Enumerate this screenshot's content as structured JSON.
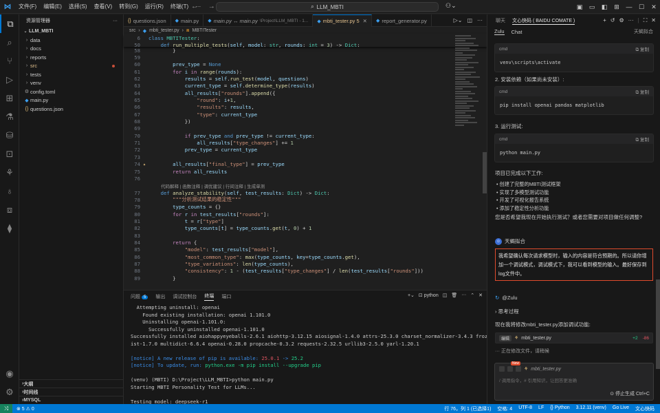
{
  "titlebar": {
    "menu": [
      "文件(F)",
      "编辑(E)",
      "选择(S)",
      "查看(V)",
      "转到(G)",
      "运行(R)",
      "终端(T)",
      "···"
    ],
    "search": "LLM_MBTI",
    "nav": "← →"
  },
  "sidebar": {
    "title": "资源管理器",
    "project": "LLM_MBTI",
    "items": [
      {
        "label": "data",
        "type": "folder"
      },
      {
        "label": "docs",
        "type": "folder"
      },
      {
        "label": "reports",
        "type": "folder"
      },
      {
        "label": "src",
        "type": "folder",
        "modified": true
      },
      {
        "label": "tests",
        "type": "folder"
      },
      {
        "label": "venv",
        "type": "folder"
      },
      {
        "label": "config.toml",
        "type": "file",
        "icon": "gear-icon"
      },
      {
        "label": "main.py",
        "type": "file",
        "icon": "python-icon"
      },
      {
        "label": "questions.json",
        "type": "file",
        "icon": "json-icon"
      }
    ],
    "sections": [
      "大纲",
      "时间线",
      "MYSQL"
    ]
  },
  "tabs": [
    {
      "label": "questions.json",
      "icon": "{}",
      "active": false
    },
    {
      "label": "main.py",
      "icon": "◆",
      "active": false
    },
    {
      "label": "main.py ↔ main.py",
      "sub": "\\Project\\LLM_MBTI - 1...",
      "icon": "◆",
      "active": false,
      "italic": true
    },
    {
      "label": "mbti_tester.py 5",
      "icon": "◆",
      "active": true,
      "modified": true
    },
    {
      "label": "report_generator.py",
      "icon": "◆",
      "active": false
    }
  ],
  "breadcrumb": [
    "src",
    "mbti_tester.py",
    "MBTITester"
  ],
  "sticky": [
    {
      "ln": "6",
      "html": "<span class='k'>class</span> <span class='c'>MBTITester</span>:"
    },
    {
      "ln": "50",
      "html": "    <span class='k'>def</span> <span class='f'>run_multiple_tests</span>(<span class='v'>self</span>, <span class='v'>model</span>: <span class='c'>str</span>, <span class='v'>rounds</span>: <span class='c'>int</span> = <span class='n'>3</span>) -> <span class='c'>Dict</span>:"
    }
  ],
  "code": [
    {
      "ln": "58",
      "html": "        <span class='p'>}</span>"
    },
    {
      "ln": "59",
      "html": ""
    },
    {
      "ln": "60",
      "html": "        <span class='v'>prev_type</span> = <span class='k'>None</span>"
    },
    {
      "ln": "61",
      "html": "        <span class='kc'>for</span> <span class='v'>i</span> <span class='kc'>in</span> <span class='f'>range</span>(<span class='v'>rounds</span>):"
    },
    {
      "ln": "62",
      "html": "            <span class='v'>results</span> = <span class='v'>self</span>.<span class='f'>run_test</span>(<span class='v'>model</span>, <span class='v'>questions</span>)"
    },
    {
      "ln": "63",
      "html": "            <span class='v'>current_type</span> = <span class='v'>self</span>.<span class='f'>determine_type</span>(<span class='v'>results</span>)"
    },
    {
      "ln": "64",
      "html": "            <span class='v'>all_results</span>[<span class='s'>\"rounds\"</span>].<span class='f'>append</span>({"
    },
    {
      "ln": "65",
      "html": "                <span class='s'>\"round\"</span>: <span class='v'>i</span>+<span class='n'>1</span>,"
    },
    {
      "ln": "66",
      "html": "                <span class='s'>\"results\"</span>: <span class='v'>results</span>,"
    },
    {
      "ln": "67",
      "html": "                <span class='s'>\"type\"</span>: <span class='v'>current_type</span>"
    },
    {
      "ln": "68",
      "html": "            })"
    },
    {
      "ln": "69",
      "html": ""
    },
    {
      "ln": "70",
      "html": "            <span class='kc'>if</span> <span class='v'>prev_type</span> <span class='k'>and</span> <span class='v'>prev_type</span> != <span class='v'>current_type</span>:"
    },
    {
      "ln": "71",
      "html": "                <span class='v'>all_results</span>[<span class='s'>\"type_changes\"</span>] += <span class='n'>1</span>"
    },
    {
      "ln": "72",
      "html": "            <span class='v'>prev_type</span> = <span class='v'>current_type</span>"
    },
    {
      "ln": "73",
      "html": ""
    },
    {
      "ln": "74",
      "html": "        <span class='v'>all_results</span>[<span class='s'>\"final_type\"</span>] = <span class='v'>prev_type</span>",
      "gutter": "✦"
    },
    {
      "ln": "75",
      "html": "        <span class='kc'>return</span> <span class='v'>all_results</span>"
    },
    {
      "ln": "76",
      "html": ""
    },
    {
      "lens": "代码解释 | 函数注释 | 调优建议 | 行间注释 | 生成单测"
    },
    {
      "ln": "77",
      "html": "    <span class='k'>def</span> <span class='f'>analyze_stability</span>(<span class='v'>self</span>, <span class='v'>test_results</span>: <span class='c'>Dict</span>) -> <span class='c'>Dict</span>:"
    },
    {
      "ln": "78",
      "html": "        <span class='s'>\"\"\"分析测试结果的稳定性\"\"\"</span>"
    },
    {
      "ln": "79",
      "html": "        <span class='v'>type_counts</span> = {}"
    },
    {
      "ln": "80",
      "html": "        <span class='kc'>for</span> <span class='v'>r</span> <span class='kc'>in</span> <span class='v'>test_results</span>[<span class='s'>\"rounds\"</span>]:"
    },
    {
      "ln": "81",
      "html": "            <span class='v'>t</span> = <span class='v'>r</span>[<span class='s'>\"type\"</span>]"
    },
    {
      "ln": "82",
      "html": "            <span class='v'>type_counts</span>[<span class='v'>t</span>] = <span class='v'>type_counts</span>.<span class='f'>get</span>(<span class='v'>t</span>, <span class='n'>0</span>) + <span class='n'>1</span>"
    },
    {
      "ln": "83",
      "html": ""
    },
    {
      "ln": "84",
      "html": "        <span class='kc'>return</span> {"
    },
    {
      "ln": "85",
      "html": "            <span class='s'>\"model\"</span>: <span class='v'>test_results</span>[<span class='s'>\"model\"</span>],"
    },
    {
      "ln": "86",
      "html": "            <span class='s'>\"most_common_type\"</span>: <span class='f'>max</span>(<span class='v'>type_counts</span>, <span class='v'>key</span>=<span class='v'>type_counts</span>.<span class='f'>get</span>),"
    },
    {
      "ln": "87",
      "html": "            <span class='s'>\"type_variations\"</span>: <span class='f'>len</span>(<span class='v'>type_counts</span>),"
    },
    {
      "ln": "88",
      "html": "            <span class='s'>\"consistency\"</span>: <span class='n'>1</span> - (<span class='v'>test_results</span>[<span class='s'>\"type_changes\"</span>] / <span class='f'>len</span>(<span class='v'>test_results</span>[<span class='s'>\"rounds\"</span>]))"
    },
    {
      "ln": "89",
      "html": "        }"
    }
  ],
  "panel": {
    "tabs": [
      "问题",
      "输出",
      "调试控制台",
      "终端",
      "端口"
    ],
    "problems_count": "5",
    "active_tab": "终端",
    "terminal_label": "python",
    "lines": [
      {
        "t": "  Attempting uninstall: openai"
      },
      {
        "t": "    Found existing installation: openai 1.101.0"
      },
      {
        "t": "    Uninstalling openai-1.101.0:"
      },
      {
        "t": "      Successfully uninstalled openai-1.101.0"
      },
      {
        "t": "Successfully installed aiohappyeyeballs-2.6.1 aiohttp-3.12.15 aiosignal-1.4.0 attrs-25.3.0 charset_normalizer-3.4.3 frozenl"
      },
      {
        "t": "ist-1.7.0 multidict-6.6.4 openai-0.28.0 propcache-0.3.2 requests-2.32.5 urllib3-2.5.0 yarl-1.20.1"
      },
      {
        "t": ""
      },
      {
        "t": "[notice] A new release of pip is available: ",
        "red": "25.0.1",
        "mid": " -> ",
        "green": "25.2",
        "notice": true
      },
      {
        "t": "[notice] To update, run: ",
        "green2": "python.exe -m pip install --upgrade pip",
        "notice": true
      },
      {
        "t": ""
      },
      {
        "t": "(venv) (MBTI) D:\\Project\\LLM_MBTI>python main.py"
      },
      {
        "t": "Starting MBTI Personality Test for LLMs..."
      },
      {
        "t": ""
      },
      {
        "t": "Testing model: deepseek-r1"
      }
    ]
  },
  "chat": {
    "tabs": [
      "聊天",
      "文心快码 ( BAIDU COMATE )"
    ],
    "sub_tabs": [
      "Zulu",
      "Chat"
    ],
    "user_corner": "天蝎拟合",
    "cmd_label": "cmd",
    "copy_label": "复制",
    "blocks": [
      {
        "code": "venv\\scripts\\activate"
      },
      {
        "code": "pip install openai pandas matplotlib"
      },
      {
        "code": "python main.py"
      }
    ],
    "step2": "2. 安装依赖（如果尚未安装）:",
    "step3": "3. 运行测试:",
    "done_title": "项目已完成以下工作:",
    "bullets": [
      "创建了完整的MBTI测试框架",
      "实现了多模型测试功能",
      "开发了可视化报告系统",
      "添加了稳定性分析功能"
    ],
    "question": "您是否希望我现在开始执行测试？或者您需要对项目做任何调整?",
    "user_name": "天蝎拟合",
    "user_message": "我希望确认每次请求模型时，输入的内容是符合预期的。所以请你增加一个调试模式，调试模式下，我可以看到模型的输入。最好保存到log文件中。",
    "ai_name": "@Zulu",
    "thinking": "思考过程",
    "ai_reply": "现在我将修改mbti_tester.py添加调试功能:",
    "file_chip": {
      "edit": "编辑",
      "file": "mbti_tester.py",
      "plus": "+2",
      "minus": "-86"
    },
    "status": "正在修改文件，请稍候",
    "input_file": "mbti_tester.py",
    "input_new": "New",
    "input_placeholder": "/ 调用指令，# 引用知识，让回答更准确",
    "stop": "停止生成 Ctrl+C"
  },
  "statusbar": {
    "left": "⊗ 5 ⚠ 0",
    "items": [
      "行 76，列 1 (已选择1)",
      "空格: 4",
      "UTF-8",
      "LF",
      "{} Python",
      "3.12.11 (venv)",
      "Go Live",
      "文心快码"
    ]
  }
}
